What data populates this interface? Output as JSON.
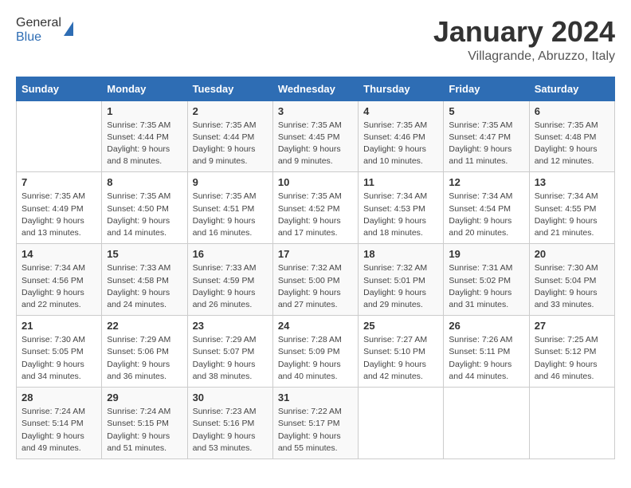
{
  "header": {
    "logo_general": "General",
    "logo_blue": "Blue",
    "title": "January 2024",
    "subtitle": "Villagrande, Abruzzo, Italy"
  },
  "days_of_week": [
    "Sunday",
    "Monday",
    "Tuesday",
    "Wednesday",
    "Thursday",
    "Friday",
    "Saturday"
  ],
  "weeks": [
    [
      {
        "day": "",
        "info": ""
      },
      {
        "day": "1",
        "info": "Sunrise: 7:35 AM\nSunset: 4:44 PM\nDaylight: 9 hours\nand 8 minutes."
      },
      {
        "day": "2",
        "info": "Sunrise: 7:35 AM\nSunset: 4:44 PM\nDaylight: 9 hours\nand 9 minutes."
      },
      {
        "day": "3",
        "info": "Sunrise: 7:35 AM\nSunset: 4:45 PM\nDaylight: 9 hours\nand 9 minutes."
      },
      {
        "day": "4",
        "info": "Sunrise: 7:35 AM\nSunset: 4:46 PM\nDaylight: 9 hours\nand 10 minutes."
      },
      {
        "day": "5",
        "info": "Sunrise: 7:35 AM\nSunset: 4:47 PM\nDaylight: 9 hours\nand 11 minutes."
      },
      {
        "day": "6",
        "info": "Sunrise: 7:35 AM\nSunset: 4:48 PM\nDaylight: 9 hours\nand 12 minutes."
      }
    ],
    [
      {
        "day": "7",
        "info": "Sunrise: 7:35 AM\nSunset: 4:49 PM\nDaylight: 9 hours\nand 13 minutes."
      },
      {
        "day": "8",
        "info": "Sunrise: 7:35 AM\nSunset: 4:50 PM\nDaylight: 9 hours\nand 14 minutes."
      },
      {
        "day": "9",
        "info": "Sunrise: 7:35 AM\nSunset: 4:51 PM\nDaylight: 9 hours\nand 16 minutes."
      },
      {
        "day": "10",
        "info": "Sunrise: 7:35 AM\nSunset: 4:52 PM\nDaylight: 9 hours\nand 17 minutes."
      },
      {
        "day": "11",
        "info": "Sunrise: 7:34 AM\nSunset: 4:53 PM\nDaylight: 9 hours\nand 18 minutes."
      },
      {
        "day": "12",
        "info": "Sunrise: 7:34 AM\nSunset: 4:54 PM\nDaylight: 9 hours\nand 20 minutes."
      },
      {
        "day": "13",
        "info": "Sunrise: 7:34 AM\nSunset: 4:55 PM\nDaylight: 9 hours\nand 21 minutes."
      }
    ],
    [
      {
        "day": "14",
        "info": "Sunrise: 7:34 AM\nSunset: 4:56 PM\nDaylight: 9 hours\nand 22 minutes."
      },
      {
        "day": "15",
        "info": "Sunrise: 7:33 AM\nSunset: 4:58 PM\nDaylight: 9 hours\nand 24 minutes."
      },
      {
        "day": "16",
        "info": "Sunrise: 7:33 AM\nSunset: 4:59 PM\nDaylight: 9 hours\nand 26 minutes."
      },
      {
        "day": "17",
        "info": "Sunrise: 7:32 AM\nSunset: 5:00 PM\nDaylight: 9 hours\nand 27 minutes."
      },
      {
        "day": "18",
        "info": "Sunrise: 7:32 AM\nSunset: 5:01 PM\nDaylight: 9 hours\nand 29 minutes."
      },
      {
        "day": "19",
        "info": "Sunrise: 7:31 AM\nSunset: 5:02 PM\nDaylight: 9 hours\nand 31 minutes."
      },
      {
        "day": "20",
        "info": "Sunrise: 7:30 AM\nSunset: 5:04 PM\nDaylight: 9 hours\nand 33 minutes."
      }
    ],
    [
      {
        "day": "21",
        "info": "Sunrise: 7:30 AM\nSunset: 5:05 PM\nDaylight: 9 hours\nand 34 minutes."
      },
      {
        "day": "22",
        "info": "Sunrise: 7:29 AM\nSunset: 5:06 PM\nDaylight: 9 hours\nand 36 minutes."
      },
      {
        "day": "23",
        "info": "Sunrise: 7:29 AM\nSunset: 5:07 PM\nDaylight: 9 hours\nand 38 minutes."
      },
      {
        "day": "24",
        "info": "Sunrise: 7:28 AM\nSunset: 5:09 PM\nDaylight: 9 hours\nand 40 minutes."
      },
      {
        "day": "25",
        "info": "Sunrise: 7:27 AM\nSunset: 5:10 PM\nDaylight: 9 hours\nand 42 minutes."
      },
      {
        "day": "26",
        "info": "Sunrise: 7:26 AM\nSunset: 5:11 PM\nDaylight: 9 hours\nand 44 minutes."
      },
      {
        "day": "27",
        "info": "Sunrise: 7:25 AM\nSunset: 5:12 PM\nDaylight: 9 hours\nand 46 minutes."
      }
    ],
    [
      {
        "day": "28",
        "info": "Sunrise: 7:24 AM\nSunset: 5:14 PM\nDaylight: 9 hours\nand 49 minutes."
      },
      {
        "day": "29",
        "info": "Sunrise: 7:24 AM\nSunset: 5:15 PM\nDaylight: 9 hours\nand 51 minutes."
      },
      {
        "day": "30",
        "info": "Sunrise: 7:23 AM\nSunset: 5:16 PM\nDaylight: 9 hours\nand 53 minutes."
      },
      {
        "day": "31",
        "info": "Sunrise: 7:22 AM\nSunset: 5:17 PM\nDaylight: 9 hours\nand 55 minutes."
      },
      {
        "day": "",
        "info": ""
      },
      {
        "day": "",
        "info": ""
      },
      {
        "day": "",
        "info": ""
      }
    ]
  ]
}
